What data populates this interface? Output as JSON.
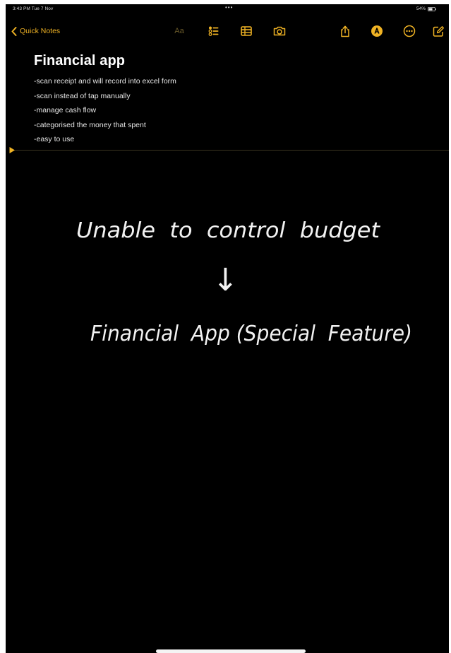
{
  "status_bar": {
    "time": "3:43 PM  Tue 7 Nov",
    "dots": "•••",
    "battery": "54%"
  },
  "toolbar": {
    "back_label": "Quick Notes",
    "format_label": "Aa",
    "icons": [
      "checklist-icon",
      "table-icon",
      "camera-icon",
      "share-icon",
      "markup-icon",
      "more-icon",
      "compose-icon"
    ]
  },
  "note": {
    "title": "Financial app",
    "lines": [
      "-scan receipt and will record into excel form",
      "-scan instead of tap manually",
      "-manage cash flow",
      "-categorised the money that spent",
      "-easy to use"
    ]
  },
  "drawing": {
    "line1": "Unable  to  control  budget",
    "arrow": "↓",
    "line2": "Financial  App (Special  Feature)"
  },
  "colors": {
    "accent": "#f0b324",
    "background": "#000000",
    "text": "#ffffff"
  }
}
